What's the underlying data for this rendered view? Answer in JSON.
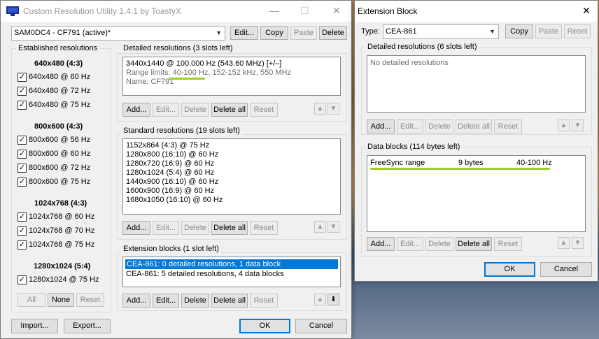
{
  "main_window": {
    "title": "Custom Resolution Utility 1.4.1 by ToastyX",
    "monitor_select": "SAM0DC4 - CF791 (active)*",
    "buttons": {
      "edit": "Edit...",
      "copy": "Copy",
      "paste": "Paste",
      "delete": "Delete"
    },
    "established": {
      "label": "Established resolutions",
      "groups": [
        {
          "header": "640x480 (4:3)",
          "items": [
            {
              "label": "640x480 @ 60 Hz",
              "checked": true
            },
            {
              "label": "640x480 @ 72 Hz",
              "checked": true
            },
            {
              "label": "640x480 @ 75 Hz",
              "checked": true
            }
          ]
        },
        {
          "header": "800x600 (4:3)",
          "items": [
            {
              "label": "800x600 @ 56 Hz",
              "checked": true
            },
            {
              "label": "800x600 @ 60 Hz",
              "checked": true
            },
            {
              "label": "800x600 @ 72 Hz",
              "checked": true
            },
            {
              "label": "800x600 @ 75 Hz",
              "checked": true
            }
          ]
        },
        {
          "header": "1024x768 (4:3)",
          "items": [
            {
              "label": "1024x768 @ 60 Hz",
              "checked": true
            },
            {
              "label": "1024x768 @ 70 Hz",
              "checked": true
            },
            {
              "label": "1024x768 @ 75 Hz",
              "checked": true
            }
          ]
        },
        {
          "header": "1280x1024 (5:4)",
          "items": [
            {
              "label": "1280x1024 @ 75 Hz",
              "checked": true
            }
          ]
        }
      ],
      "buttons": {
        "all": "All",
        "none": "None",
        "reset": "Reset"
      }
    },
    "detailed": {
      "label": "Detailed resolutions (3 slots left)",
      "lines": [
        "3440x1440 @ 100.000 Hz (543.60 MHz) [+/–]",
        "Range limits: 40-100 Hz, 152-152 kHz, 550 MHz",
        "Name: CF791"
      ]
    },
    "standard": {
      "label": "Standard resolutions (19 slots left)",
      "items": [
        "1152x864 (4:3) @ 75 Hz",
        "1280x800 (16:10) @ 60 Hz",
        "1280x720 (16:9) @ 60 Hz",
        "1280x1024 (5:4) @ 60 Hz",
        "1440x900 (16:10) @ 60 Hz",
        "1600x900 (16:9) @ 60 Hz",
        "1680x1050 (16:10) @ 60 Hz"
      ]
    },
    "extension": {
      "label": "Extension blocks (1 slot left)",
      "items": [
        "CEA-861: 0 detailed resolutions, 1 data block",
        "CEA-861: 5 detailed resolutions, 4 data blocks"
      ]
    },
    "row_buttons": {
      "add": "Add...",
      "edit": "Edit...",
      "delete": "Delete",
      "delete_all": "Delete all",
      "reset": "Reset"
    },
    "footer": {
      "import": "Import...",
      "export": "Export...",
      "ok": "OK",
      "cancel": "Cancel"
    }
  },
  "ext_window": {
    "title": "Extension Block",
    "type_label": "Type:",
    "type_value": "CEA-861",
    "buttons": {
      "copy": "Copy",
      "paste": "Paste",
      "reset": "Reset"
    },
    "detailed": {
      "label": "Detailed resolutions (6 slots left)",
      "empty": "No detailed resolutions"
    },
    "data_blocks": {
      "label": "Data blocks (114 bytes left)",
      "row": {
        "name": "FreeSync range",
        "size": "9 bytes",
        "value": "40-100 Hz"
      }
    },
    "row_buttons": {
      "add": "Add...",
      "edit": "Edit...",
      "delete": "Delete",
      "delete_all": "Delete all",
      "reset": "Reset"
    },
    "footer": {
      "ok": "OK",
      "cancel": "Cancel"
    }
  },
  "accent_color": "#0078d7",
  "highlight_color": "#9bd11a"
}
